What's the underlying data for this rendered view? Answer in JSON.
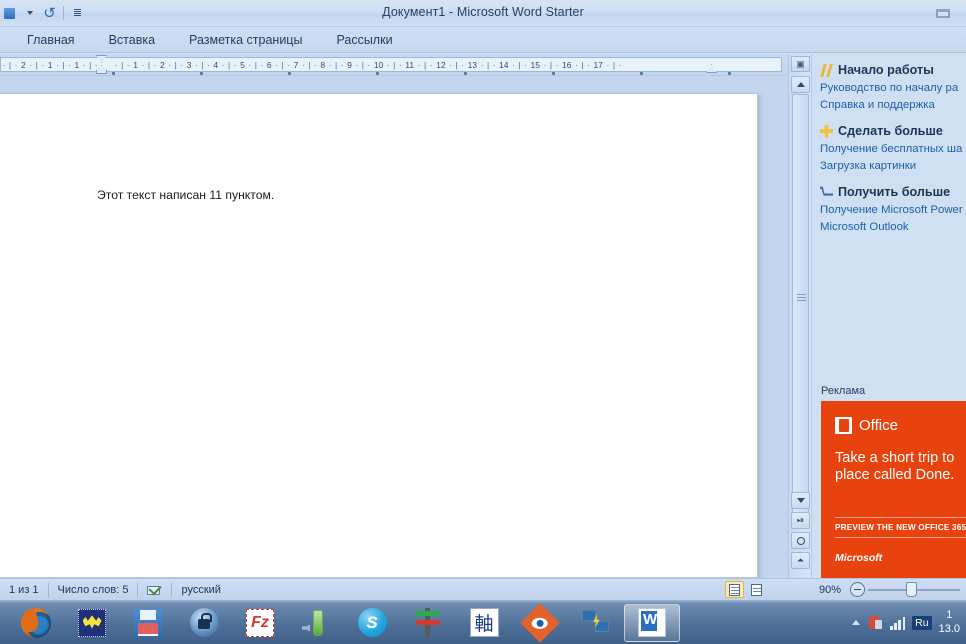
{
  "window": {
    "title": "Документ1 - Microsoft Word Starter",
    "restore_label": "❐"
  },
  "quick_access": {
    "save": "save-icon",
    "save_caret": "▾",
    "undo": "↺",
    "customize_caret": "▾"
  },
  "ribbon": {
    "tabs": [
      {
        "label": "Главная"
      },
      {
        "label": "Вставка"
      },
      {
        "label": "Разметка страницы"
      },
      {
        "label": "Рассылки"
      }
    ]
  },
  "ruler": {
    "left_numbers": [
      "2",
      "1",
      "1"
    ],
    "numbers": [
      "1",
      "2",
      "3",
      "4",
      "5",
      "6",
      "7",
      "8",
      "9",
      "10",
      "11",
      "12",
      "13",
      "14",
      "15",
      "16",
      "17"
    ]
  },
  "document": {
    "body_text": "Этот текст написан 11 пунктом."
  },
  "scrollbar": {
    "split_icon": "split-box-icon",
    "up_arrow": "▲",
    "down_arrow": "▼",
    "prev_page": "prev-page-icon",
    "select_object": "select-browse-object-icon",
    "next_page": "next-page-icon"
  },
  "sidebar": {
    "groups": [
      {
        "icon": "sparkle-icon",
        "heading": "Начало работы",
        "links": [
          "Руководство по началу ра",
          "Справка и поддержка"
        ]
      },
      {
        "icon": "plus-icon",
        "heading": "Сделать больше",
        "links": [
          "Получение бесплатных ша",
          "Загрузка картинки"
        ]
      },
      {
        "icon": "cart-icon",
        "heading": "Получить больше",
        "links": [
          "Получение Microsoft Power",
          "Microsoft Outlook"
        ]
      }
    ],
    "ad_label": "Реклама",
    "ad": {
      "brand": "Office",
      "message": "Take a short trip to\nplace called Done.",
      "cta": "PREVIEW THE NEW OFFICE 365",
      "publisher": "Microsoft",
      "bg_color": "#e8430f"
    }
  },
  "status_bar": {
    "page": "1 из 1",
    "word_count": "Число слов: 5",
    "spell_icon": "spell-check-icon",
    "language": "русский",
    "views": [
      {
        "name": "print-layout-view",
        "active": true
      },
      {
        "name": "full-screen-reading-view",
        "active": false
      },
      {
        "name": "web-layout-view",
        "active": false
      },
      {
        "name": "draft-view",
        "active": false
      }
    ],
    "zoom": "90%",
    "zoom_out": "−",
    "zoom_in": "+"
  },
  "taskbar": {
    "items": [
      {
        "name": "firefox",
        "glyph": "g-fox",
        "active": false
      },
      {
        "name": "the-bat-mail",
        "glyph": "g-bat",
        "active": false
      },
      {
        "name": "save-floppy-app",
        "glyph": "g-floppy",
        "active": false
      },
      {
        "name": "keepass-lock",
        "glyph": "g-lock",
        "active": false
      },
      {
        "name": "filezilla",
        "glyph": "g-fz",
        "active": false
      },
      {
        "name": "green-tube-app",
        "glyph": "g-tube",
        "active": false
      },
      {
        "name": "skype",
        "glyph": "g-skype",
        "active": false
      },
      {
        "name": "git-app",
        "glyph": "g-git",
        "active": false
      },
      {
        "name": "cjk-app",
        "glyph": "g-cjk",
        "active": false
      },
      {
        "name": "faststone-viewer",
        "glyph": "g-eye",
        "active": false
      },
      {
        "name": "remote-desktop",
        "glyph": "g-rdp",
        "active": false
      },
      {
        "name": "microsoft-word",
        "glyph": "g-word",
        "active": true
      }
    ],
    "cjk_char": "軸",
    "fz_char": "Fz",
    "skype_char": "S",
    "tray": {
      "show_hidden": "▲",
      "network_icon": "network-icon",
      "signal_icon": "signal-bars-icon",
      "language": "Ru",
      "clock_time": "1",
      "clock_date": "13.0"
    }
  }
}
